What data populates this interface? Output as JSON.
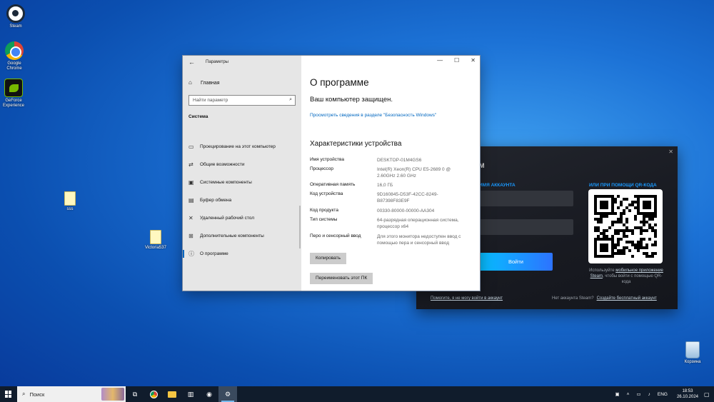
{
  "desktop": {
    "icons": [
      {
        "label": "Steam"
      },
      {
        "label": "Google Chrome"
      },
      {
        "label": "GeForce Experience"
      },
      {
        "label": "sss"
      },
      {
        "label": "Victoria537"
      },
      {
        "label": "Корзина"
      }
    ]
  },
  "settings": {
    "window_title": "Параметры",
    "back_icon": "back-arrow-icon",
    "home_label": "Главная",
    "search_placeholder": "Найти параметр",
    "section_label": "Система",
    "nav": [
      {
        "label": "Проецирование на этот компьютер",
        "icon": "projector-icon"
      },
      {
        "label": "Общие возможности",
        "icon": "share-icon"
      },
      {
        "label": "Системные компоненты",
        "icon": "components-icon"
      },
      {
        "label": "Буфер обмена",
        "icon": "clipboard-icon"
      },
      {
        "label": "Удаленный рабочий стол",
        "icon": "remote-desktop-icon"
      },
      {
        "label": "Дополнительные компоненты",
        "icon": "optional-components-icon"
      },
      {
        "label": "О программе",
        "icon": "info-icon"
      }
    ],
    "main": {
      "title": "О программе",
      "protection": "Ваш компьютер защищен.",
      "security_link": "Просмотреть сведения в разделе \"Безопасность Windows\"",
      "specs_title": "Характеристики устройства",
      "specs": [
        {
          "key": "Имя устройства",
          "value": "DESKTOP-01M4GS6"
        },
        {
          "key": "Процессор",
          "value": "Intel(R) Xeon(R) CPU E5-2689 0 @ 2.60GHz   2.60 GHz"
        },
        {
          "key": "Оперативная память",
          "value": "16,0 ГБ"
        },
        {
          "key": "Код устройства",
          "value": "9D160845-D53F-42CC-8249-B87398F83E9F"
        },
        {
          "key": "Код продукта",
          "value": "00330-80000-00000-AA304"
        },
        {
          "key": "Тип системы",
          "value": "64-разрядная операционная система, процессор x64"
        },
        {
          "key": "Перо и сенсорный ввод",
          "value": "Для этого монитора недоступен ввод с помощью пера и сенсорный ввод"
        }
      ],
      "copy_button": "Копировать",
      "rename_button": "Переименовать этот ПК"
    }
  },
  "steam_login": {
    "logo_text": "M",
    "account_label": "ИМЯ АККАУНТА",
    "login_button": "Войти",
    "qr_label": "ИЛИ ПРИ ПОМОЩИ QR-КОДА",
    "qr_note_prefix": "Используйте",
    "qr_note_link": "мобильное приложение Steam",
    "qr_note_suffix": ", чтобы войти с помощью QR-кода",
    "help_link": "Помогите, я не могу войти в аккаунт",
    "no_account": "Нет аккаунта Steam?",
    "create_account": "Создайте бесплатный аккаунт"
  },
  "taskbar": {
    "search_label": "Поиск",
    "lang": "ENG",
    "time": "18:53",
    "date": "26.10.2024"
  }
}
